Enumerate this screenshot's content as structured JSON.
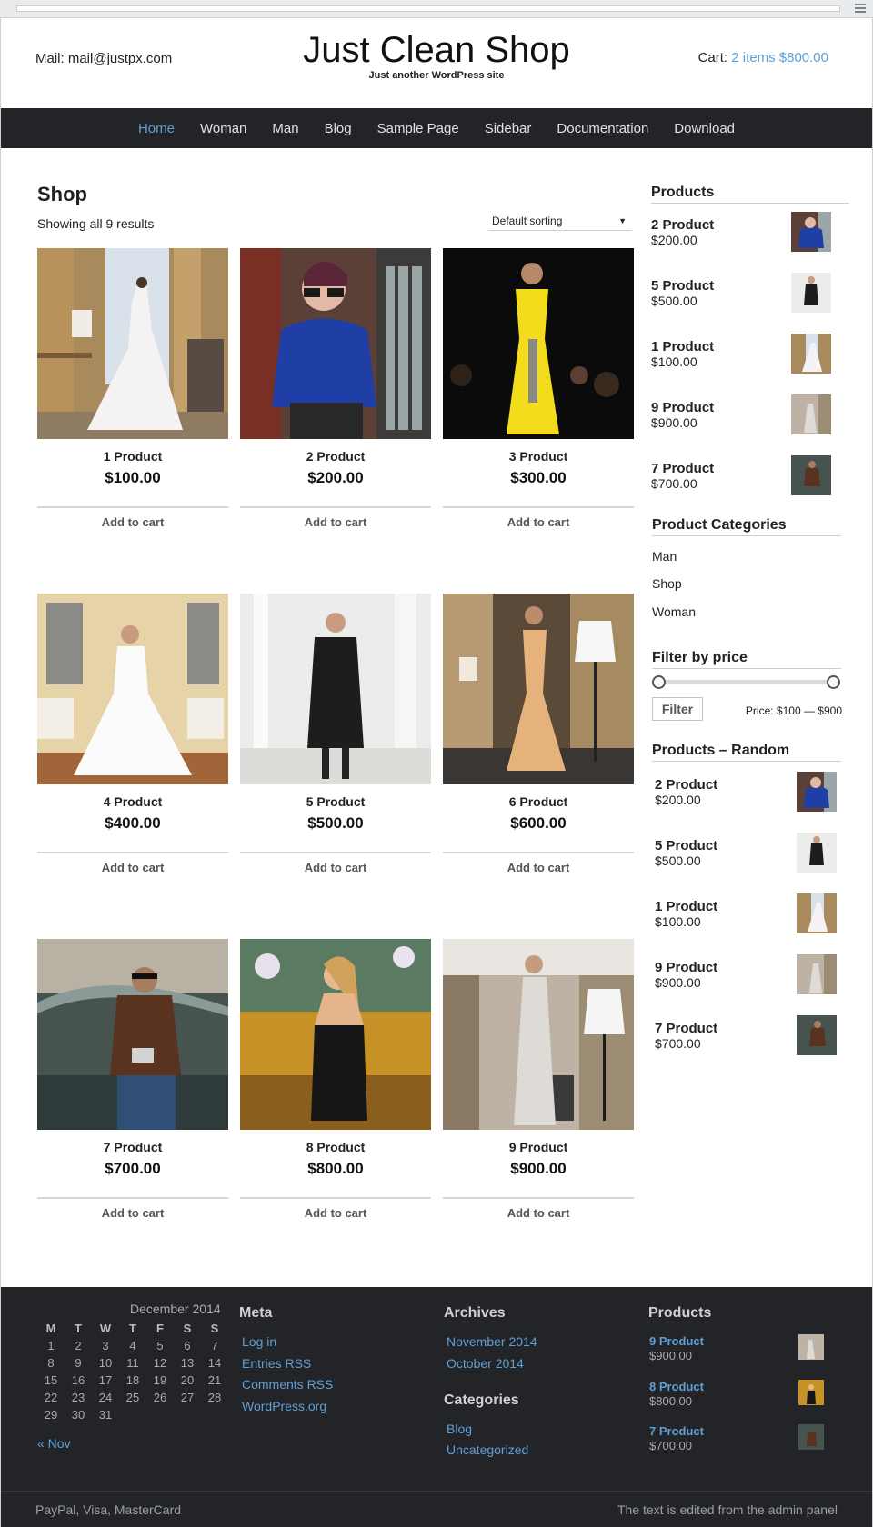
{
  "header": {
    "mail": "Mail: mail@justpx.com",
    "site_title": "Just Clean Shop",
    "tagline": "Just another WordPress site",
    "cart_label": "Cart:",
    "cart_link": "2 items $800.00"
  },
  "nav": {
    "items": [
      "Home",
      "Woman",
      "Man",
      "Blog",
      "Sample Page",
      "Sidebar",
      "Documentation",
      "Download"
    ],
    "active": "Home",
    "active_color": "#5f9fd3",
    "bar_color": "#222428"
  },
  "shop": {
    "title": "Shop",
    "result_count": "Showing all 9 results",
    "sorting": "Default sorting"
  },
  "products": [
    {
      "name": "1 Product",
      "price": "$100.00",
      "cta": "Add to cart",
      "image": "bride-white-gown-window"
    },
    {
      "name": "2 Product",
      "price": "$200.00",
      "cta": "Add to cart",
      "image": "woman-blue-lace-sunglasses"
    },
    {
      "name": "3 Product",
      "price": "$300.00",
      "cta": "Add to cart",
      "image": "yellow-dress-runway"
    },
    {
      "name": "4 Product",
      "price": "$400.00",
      "cta": "Add to cart",
      "image": "bride-ball-gown"
    },
    {
      "name": "5 Product",
      "price": "$500.00",
      "cta": "Add to cart",
      "image": "woman-black-dress-studio"
    },
    {
      "name": "6 Product",
      "price": "$600.00",
      "cta": "Add to cart",
      "image": "woman-gold-gown-lamp"
    },
    {
      "name": "7 Product",
      "price": "$700.00",
      "cta": "Add to cart",
      "image": "man-leather-jacket-camera"
    },
    {
      "name": "8 Product",
      "price": "$800.00",
      "cta": "Add to cart",
      "image": "woman-black-dress-painting"
    },
    {
      "name": "9 Product",
      "price": "$900.00",
      "cta": "Add to cart",
      "image": "woman-silver-dress-lamp"
    }
  ],
  "sidebar": {
    "products_title": "Products",
    "products": [
      {
        "name": "2 Product",
        "price": "$200.00"
      },
      {
        "name": "5 Product",
        "price": "$500.00"
      },
      {
        "name": "1 Product",
        "price": "$100.00"
      },
      {
        "name": "9 Product",
        "price": "$900.00"
      },
      {
        "name": "7 Product",
        "price": "$700.00"
      }
    ],
    "categories_title": "Product Categories",
    "categories": [
      "Man",
      "Shop",
      "Woman"
    ],
    "filter_title": "Filter by price",
    "filter_button": "Filter",
    "price_range": "Price: $100 — $900",
    "random_title": "Products – Random",
    "random_products": [
      {
        "name": "2 Product",
        "price": "$200.00"
      },
      {
        "name": "5 Product",
        "price": "$500.00"
      },
      {
        "name": "1 Product",
        "price": "$100.00"
      },
      {
        "name": "9 Product",
        "price": "$900.00"
      },
      {
        "name": "7 Product",
        "price": "$700.00"
      }
    ]
  },
  "footer": {
    "calendar": {
      "caption": "December 2014",
      "weekdays": [
        "M",
        "T",
        "W",
        "T",
        "F",
        "S",
        "S"
      ],
      "weeks": [
        [
          "1",
          "2",
          "3",
          "4",
          "5",
          "6",
          "7"
        ],
        [
          "8",
          "9",
          "10",
          "11",
          "12",
          "13",
          "14"
        ],
        [
          "15",
          "16",
          "17",
          "18",
          "19",
          "20",
          "21"
        ],
        [
          "22",
          "23",
          "24",
          "25",
          "26",
          "27",
          "28"
        ],
        [
          "29",
          "30",
          "31",
          "",
          "",
          "",
          ""
        ]
      ],
      "prev": "« Nov"
    },
    "meta_title": "Meta",
    "meta_links": [
      "Log in",
      "Entries RSS",
      "Comments RSS",
      "WordPress.org"
    ],
    "archives_title": "Archives",
    "archives": [
      "November 2014",
      "October 2014"
    ],
    "categories_title": "Categories",
    "categories": [
      "Blog",
      "Uncategorized"
    ],
    "products_title": "Products",
    "products": [
      {
        "name": "9 Product",
        "price": "$900.00"
      },
      {
        "name": "8 Product",
        "price": "$800.00"
      },
      {
        "name": "7 Product",
        "price": "$700.00"
      }
    ],
    "left_text": "PayPal, Visa, MasterCard",
    "right_text": "The text is edited from the admin panel"
  }
}
